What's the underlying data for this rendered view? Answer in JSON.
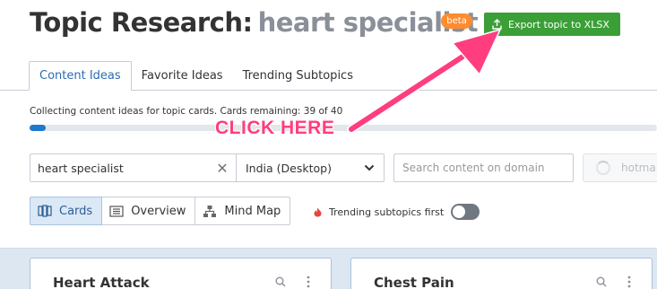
{
  "header": {
    "title": "Topic Research:",
    "topic": "heart specialist",
    "beta_badge": "beta",
    "export_label": "Export topic to XLSX"
  },
  "tabs": [
    {
      "label": "Content Ideas",
      "active": true
    },
    {
      "label": "Favorite Ideas",
      "active": false
    },
    {
      "label": "Trending Subtopics",
      "active": false
    }
  ],
  "progress": {
    "text": "Collecting content ideas for topic cards. Cards remaining: 39 of 40",
    "fraction": 0.025
  },
  "annotation": {
    "text": "CLICK HERE",
    "color": "#ff3d7f"
  },
  "filters": {
    "search_value": "heart specialist",
    "region": "India (Desktop)",
    "domain_placeholder": "Search content on domain",
    "loading_value": "hotma"
  },
  "view_switch": {
    "cards": "Cards",
    "overview": "Overview",
    "mind_map": "Mind Map",
    "active": "cards"
  },
  "trending": {
    "label": "Trending subtopics first",
    "enabled": false
  },
  "cards": [
    {
      "title": "Heart Attack"
    },
    {
      "title": "Chest Pain"
    }
  ],
  "colors": {
    "accent_blue": "#1e7acf",
    "export_green": "#3b9f37",
    "beta_orange": "#ff8c2f"
  }
}
